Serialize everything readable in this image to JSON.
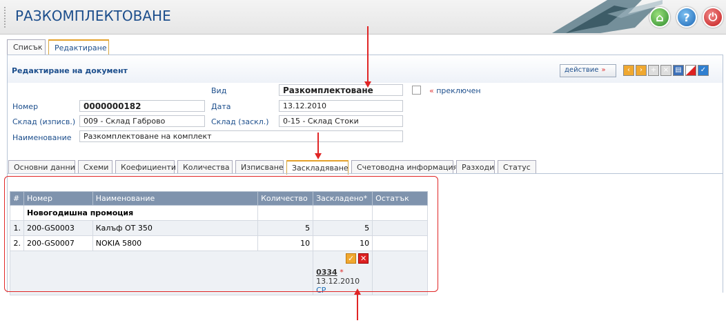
{
  "app": {
    "title": "РАЗКОМПЛЕКТОВАНЕ"
  },
  "top_tabs": [
    {
      "label": "Списък"
    },
    {
      "label": "Редактиране"
    }
  ],
  "header": {
    "title": "Редактиране на документ",
    "action_label": "действие",
    "action_arrow": "»"
  },
  "form": {
    "vid_label": "Вид",
    "vid_value": "Разкомплектоване",
    "switched_label": "преключен",
    "switched_quote": "«",
    "number_label": "Номер",
    "number_value": "0000000182",
    "date_label": "Дата",
    "date_value": "13.12.2010",
    "warehouse_out_label": "Склад (изписв.)",
    "warehouse_out_value": "009 - Склад Габрово",
    "warehouse_in_label": "Склад (заскл.)",
    "warehouse_in_value": "0-15 - Склад Стоки",
    "name_label": "Наименование",
    "name_value": "Разкомплектоване на комплект"
  },
  "section_tabs": [
    {
      "label": "Основни данни"
    },
    {
      "label": "Схеми"
    },
    {
      "label": "Коефициенти"
    },
    {
      "label": "Количества"
    },
    {
      "label": "Изписване"
    },
    {
      "label": "Заскладяване"
    },
    {
      "label": "Счетоводна информация"
    },
    {
      "label": "Разходи"
    },
    {
      "label": "Статус"
    }
  ],
  "table": {
    "headers": [
      "#",
      "Номер",
      "Наименование",
      "Количество",
      "Заскладено*",
      "Остатък"
    ],
    "group": "Новогодишна промоция",
    "rows": [
      {
        "num": "1.",
        "code": "200-GS0003",
        "name": "Калъф OT 350",
        "qty": "5",
        "stored": "5",
        "rest": ""
      },
      {
        "num": "2.",
        "code": "200-GS0007",
        "name": "NOKIA 5800",
        "qty": "10",
        "stored": "10",
        "rest": ""
      }
    ],
    "receipt_no": "0334",
    "receipt_star": "*",
    "receipt_date": "13.12.2010",
    "receipt_suffix": "СР"
  },
  "colors": {
    "accent": "#1c4e8c",
    "annotation": "#e02525",
    "tab_active": "#e4a12a"
  }
}
